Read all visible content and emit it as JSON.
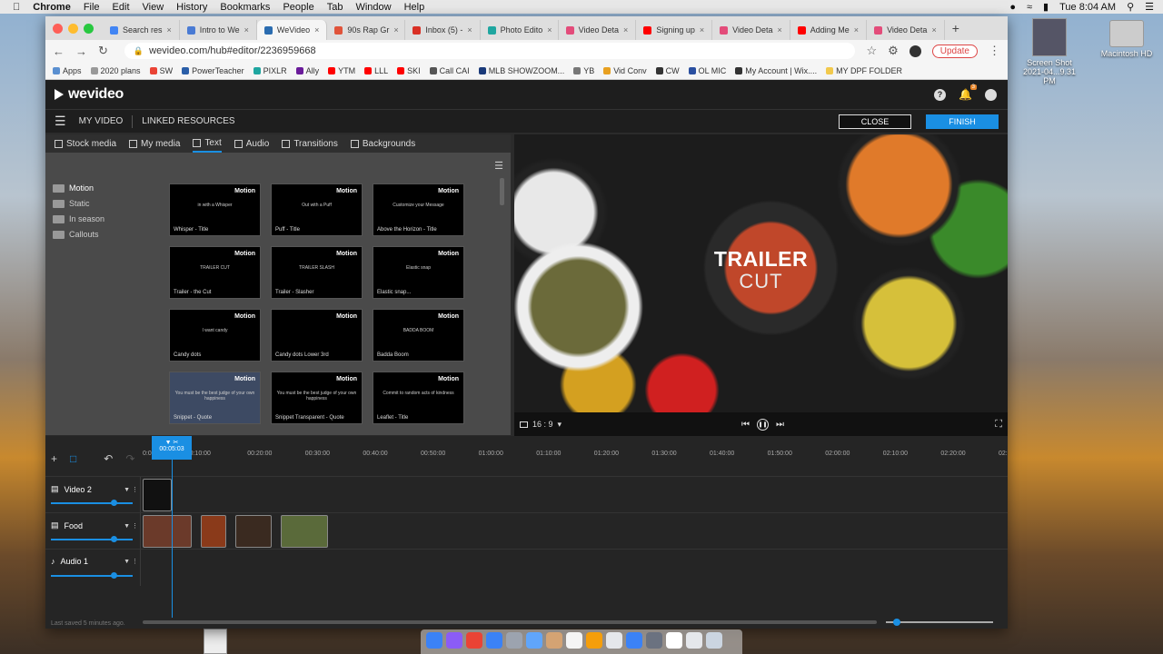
{
  "menubar": {
    "app": "Chrome",
    "items": [
      "File",
      "Edit",
      "View",
      "History",
      "Bookmarks",
      "People",
      "Tab",
      "Window",
      "Help"
    ],
    "time": "Tue 8:04 AM"
  },
  "desktop": {
    "items": [
      {
        "label": "Screen Shot",
        "sub": "2021-04...9.31 PM"
      },
      {
        "label": "Macintosh HD",
        "sub": ""
      }
    ]
  },
  "browser": {
    "tabs": [
      {
        "label": "Search res",
        "color": "#4285f4"
      },
      {
        "label": "Intro to We",
        "color": "#4a7bd4"
      },
      {
        "label": "WeVideo",
        "color": "#2b6cb0",
        "active": true
      },
      {
        "label": "90s Rap Gr",
        "color": "#e0533a"
      },
      {
        "label": "Inbox (5) -",
        "color": "#d93025"
      },
      {
        "label": "Photo Edito",
        "color": "#1fa6a0"
      },
      {
        "label": "Video Deta",
        "color": "#e34c7a"
      },
      {
        "label": "Signing up",
        "color": "#ff0000"
      },
      {
        "label": "Video Deta",
        "color": "#e34c7a"
      },
      {
        "label": "Adding Me",
        "color": "#ff0000"
      },
      {
        "label": "Video Deta",
        "color": "#e34c7a"
      }
    ],
    "url": "wevideo.com/hub#editor/2236959668",
    "update_label": "Update",
    "bookmarks": [
      {
        "label": "Apps",
        "color": "#5a8fd0"
      },
      {
        "label": "2020 plans",
        "color": "#999"
      },
      {
        "label": "SW",
        "color": "#ea4335"
      },
      {
        "label": "PowerTeacher",
        "color": "#2a5ea8"
      },
      {
        "label": "PIXLR",
        "color": "#1fa6a0"
      },
      {
        "label": "Ally",
        "color": "#6a1b9a"
      },
      {
        "label": "YTM",
        "color": "#ff0000"
      },
      {
        "label": "LLL",
        "color": "#ff0000"
      },
      {
        "label": "SKI",
        "color": "#ff0000"
      },
      {
        "label": "Call CAI",
        "color": "#555"
      },
      {
        "label": "MLB SHOWZOOM...",
        "color": "#1a3a7a"
      },
      {
        "label": "YB",
        "color": "#777"
      },
      {
        "label": "Vid Conv",
        "color": "#e8a020"
      },
      {
        "label": "CW",
        "color": "#333"
      },
      {
        "label": "OL MIC",
        "color": "#2a4fa0"
      },
      {
        "label": "My Account | Wix....",
        "color": "#333"
      },
      {
        "label": "MY DPF FOLDER",
        "color": "#f2c94c"
      }
    ]
  },
  "wevideo": {
    "logo": "wevideo",
    "notif_count": "3",
    "nav": {
      "my_video": "MY VIDEO",
      "linked": "LINKED RESOURCES",
      "close": "CLOSE",
      "finish": "FINISH"
    },
    "media_tabs": [
      "Stock media",
      "My media",
      "Text",
      "Audio",
      "Transitions",
      "Backgrounds"
    ],
    "folders": [
      "Motion",
      "Static",
      "In season",
      "Callouts"
    ],
    "thumbs": [
      {
        "name": "Whisper - Title",
        "caption": "in with a Whisper",
        "tag": "Motion"
      },
      {
        "name": "Puff - Title",
        "caption": "Out with a Puff",
        "tag": "Motion"
      },
      {
        "name": "Above the Horizon - Title",
        "caption": "Customize your Message",
        "tag": "Motion"
      },
      {
        "name": "Trailer - the Cut",
        "caption": "TRAILER CUT",
        "tag": "Motion"
      },
      {
        "name": "Trailer - Slasher",
        "caption": "TRAILER SLASH",
        "tag": "Motion"
      },
      {
        "name": "Elastic snap...",
        "caption": "Elastic snap",
        "tag": "Motion"
      },
      {
        "name": "Candy dots",
        "caption": "I want candy",
        "tag": "Motion"
      },
      {
        "name": "Candy dots Lower 3rd",
        "caption": "",
        "tag": "Motion"
      },
      {
        "name": "Badda Boom",
        "caption": "BADDA BOOM",
        "tag": "Motion"
      },
      {
        "name": "Snippet - Quote",
        "caption": "You must be the best judge of your own happiness",
        "tag": "Motion",
        "selected": true
      },
      {
        "name": "Snippet Transparent - Quote",
        "caption": "You must be the best judge of your own happiness",
        "tag": "Motion"
      },
      {
        "name": "Leaflet - Title",
        "caption": "Commit to random acts of kindness",
        "tag": "Motion"
      }
    ],
    "preview": {
      "title_line1": "TRAILER",
      "title_line2": "CUT",
      "aspect": "16 : 9"
    },
    "timeline": {
      "playhead_time": "00:05:03",
      "ruler": [
        "0:0",
        "0:10:00",
        "00:20:00",
        "00:30:00",
        "00:40:00",
        "00:50:00",
        "01:00:00",
        "01:10:00",
        "01:20:00",
        "01:30:00",
        "01:40:00",
        "01:50:00",
        "02:00:00",
        "02:10:00",
        "02:20:00",
        "02:3"
      ],
      "tracks": [
        {
          "label": "Video 2"
        },
        {
          "label": "Food"
        },
        {
          "label": "Audio 1"
        }
      ],
      "status": "Last saved 5 minutes ago."
    }
  }
}
